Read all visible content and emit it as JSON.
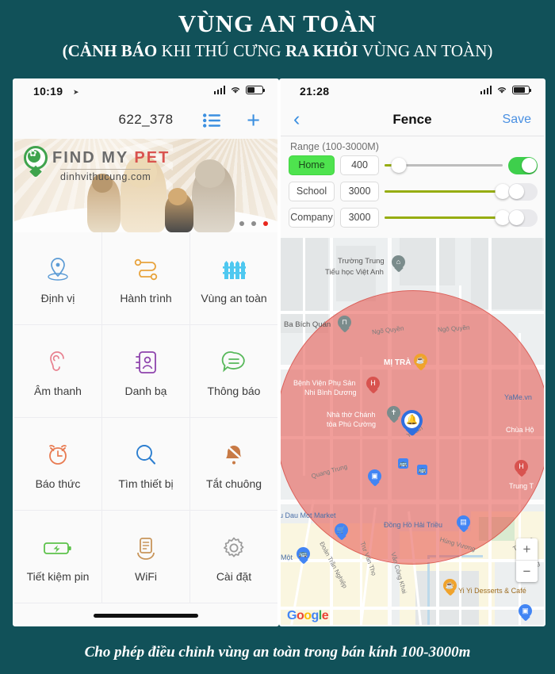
{
  "header": {
    "title": "VÙNG AN TOÀN",
    "subtitle_part1": "(CẢNH BÁO",
    "subtitle_part2": " KHI THÚ CƯNG ",
    "subtitle_part3": "RA KHỎI",
    "subtitle_part4": " VÙNG AN TOÀN)"
  },
  "footer": {
    "caption": "Cho phép điều chỉnh vùng an toàn trong bán kính  100-3000m"
  },
  "colors": {
    "background": "#115159",
    "accent_blue": "#3b8fe0",
    "toggle_on": "#3ecf4c",
    "slider_fill": "#96ad10",
    "geofence_red": "#e54f47",
    "active_green": "#4ee34e"
  },
  "left_phone": {
    "status": {
      "time": "10:19",
      "location_icon": "location-arrow",
      "signal": "signal-bars",
      "wifi": "wifi-icon",
      "battery": "battery-icon"
    },
    "header": {
      "device_id": "622_378",
      "list_icon": "list-icon",
      "add_icon": "plus-icon"
    },
    "banner": {
      "brand_first": "FIND MY ",
      "brand_accent": "PET",
      "website": "dinhvithucung.com",
      "logo_icon": "paw-pin-logo",
      "carousel_dots": 3,
      "carousel_active_index": 2
    },
    "grid": [
      [
        {
          "label": "Định vị",
          "icon": "location-pin-icon",
          "color": "#5b9bd5"
        },
        {
          "label": "Hành trình",
          "icon": "route-icon",
          "color": "#e8a33d"
        },
        {
          "label": "Vùng an toàn",
          "icon": "fence-icon",
          "color": "#4ec8f0"
        }
      ],
      [
        {
          "label": "Âm thanh",
          "icon": "ear-icon",
          "color": "#e8808f"
        },
        {
          "label": "Danh bạ",
          "icon": "contacts-icon",
          "color": "#8e44ad"
        },
        {
          "label": "Thông báo",
          "icon": "chat-bubble-icon",
          "color": "#57b85a"
        }
      ],
      [
        {
          "label": "Báo thức",
          "icon": "alarm-clock-icon",
          "color": "#e87b52"
        },
        {
          "label": "Tìm thiết bị",
          "icon": "search-icon",
          "color": "#2d7fd0"
        },
        {
          "label": "Tắt chuông",
          "icon": "bell-off-icon",
          "color": "#c87a45"
        }
      ],
      [
        {
          "label": "Tiết kiệm pin",
          "icon": "battery-saver-icon",
          "color": "#5cc24a"
        },
        {
          "label": "WiFi",
          "icon": "router-icon",
          "color": "#c8955a"
        },
        {
          "label": "Cài đặt",
          "icon": "gear-icon",
          "color": "#9a9a9a"
        }
      ]
    ]
  },
  "right_phone": {
    "status": {
      "time": "21:28",
      "signal": "signal-bars",
      "wifi": "wifi-icon",
      "battery": "battery-icon"
    },
    "nav": {
      "back_icon": "chevron-left-icon",
      "title": "Fence",
      "save_label": "Save"
    },
    "range_label": "Range  (100-3000M)",
    "fences": [
      {
        "name": "Home",
        "value": "400",
        "active": true,
        "enabled": true,
        "slider_percent": 12
      },
      {
        "name": "School",
        "value": "3000",
        "active": false,
        "enabled": false,
        "slider_percent": 100
      },
      {
        "name": "Company",
        "value": "3000",
        "active": false,
        "enabled": false,
        "slider_percent": 100
      }
    ],
    "map": {
      "center_marker_icon": "bell-pin-marker",
      "zoom_in_label": "+",
      "zoom_out_label": "−",
      "attribution": "Google",
      "labels": [
        "Trường Trung",
        "Tiểu học Việt Anh",
        "Ba Bích Quán",
        "Ngõ Quyền",
        "Ngô Quyền",
        "MỊ TRÀ",
        "Bệnh Viện Phụ Sản",
        "Nhi Bình Dương",
        "Nhà thờ Chánh",
        "tòa Phú Cường",
        "Yersin",
        "YaMe.vn",
        "Chùa Hộ",
        "Quang Trung",
        "Trung T",
        "u Dau Mot Market",
        "Đồng Hồ Hải Triều",
        "Một",
        "Đoàn Trần Nghiệp",
        "Trư Văn Thọ",
        "Văn Công Khai",
        "Hùng Vương",
        "Thích Q",
        "Đường",
        "Yi Yi Desserts & Café"
      ]
    }
  }
}
